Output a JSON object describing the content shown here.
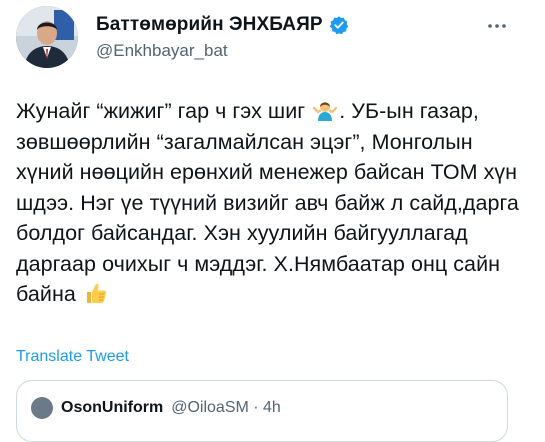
{
  "author": {
    "name": "Баттөмөрийн ЭНХБАЯР",
    "handle": "@Enkhbayar_bat",
    "verified": true
  },
  "tweet": {
    "text_before_emoji": "Жунайг “жижиг” гар ч гэх шиг ",
    "emoji": "person-shrugging-emoji",
    "text_middle": ". УБ-ын газар, зөвшөөрлийн “загалмайлсан эцэг”, Монголын хүний нөөцийн ерөнхий менежер байсан ТОМ хүн шдээ. Нэг үе түүний визийг авч байж л сайд,дарга болдог байсандаг. Хэн хуулийн байгууллагад даргаар очихыг ч мэддэг. Х.Нямбаатар онц сайн байна ",
    "end_emoji": "thumbs-up-emoji"
  },
  "actions": {
    "translate_label": "Translate Tweet"
  },
  "quoted_tweet": {
    "name": "OsonUniform",
    "handle_time": "@OiloaSM · 4h"
  },
  "colors": {
    "text": "#0f1419",
    "secondary": "#536471",
    "link": "#1d9bf0",
    "verified": "#1d9bf0",
    "border": "#cfd9de"
  }
}
